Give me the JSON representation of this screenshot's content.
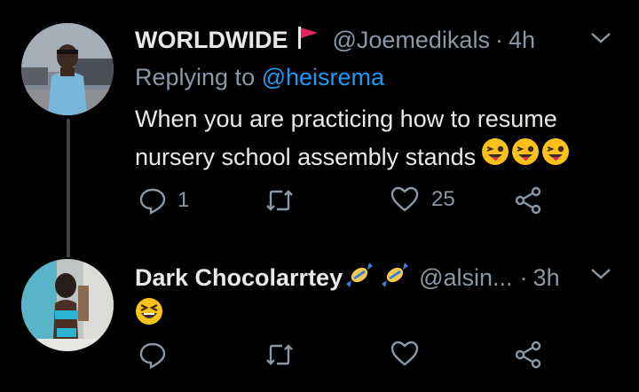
{
  "tweets": [
    {
      "display_name": "WORLDWIDE",
      "flag_icon": "red-flag-icon",
      "handle": "@Joemedikals",
      "separator": "·",
      "time": "4h",
      "replying_prefix": "Replying to",
      "replying_to": "@heisrema",
      "text_line1": "When you are practicing how to resume",
      "text_line2": "nursery school assembly stands",
      "emojis": [
        "winking-tongue-emoji",
        "winking-tongue-emoji",
        "winking-tongue-emoji"
      ],
      "reply_count": "1",
      "retweet_count": "",
      "like_count": "25"
    },
    {
      "display_name": "Dark Chocolarrtey",
      "name_emojis": [
        "candy-icon",
        "candy-icon"
      ],
      "handle": "@alsin...",
      "separator": "·",
      "time": "3h",
      "emojis": [
        "laughing-squint-emoji"
      ],
      "reply_count": "",
      "retweet_count": "",
      "like_count": ""
    }
  ],
  "colors": {
    "background": "#000000",
    "text": "#e7e9ea",
    "muted": "#8b98a5",
    "link": "#1d9bf0",
    "flag": "#e0245e"
  }
}
